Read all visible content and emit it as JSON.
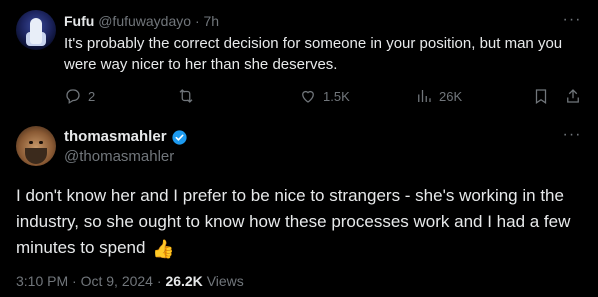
{
  "reply": {
    "name": "Fufu",
    "handle": "@fufuwaydayo",
    "separator": "·",
    "time": "7h",
    "text": "It's probably the correct decision for someone in your position, but man you were way nicer to her than she deserves.",
    "more": "···",
    "actions": {
      "replies": "2",
      "reposts": "",
      "likes": "1.5K",
      "views": "26K"
    }
  },
  "post": {
    "name": "thomasmahler",
    "handle": "@thomasmahler",
    "more": "···",
    "text": "I don't know her and I prefer to be nice to strangers - she's working in the industry, so she ought to know how these processes work and I had a few minutes to spend",
    "emoji": "👍",
    "time": "3:10 PM",
    "separator": "·",
    "date": "Oct 9, 2024",
    "separator2": "·",
    "views_count": "26.2K",
    "views_label": "Views"
  },
  "colors": {
    "background": "#000000",
    "text": "#e7e9ea",
    "muted": "#71767b",
    "verified": "#1d9bf0"
  }
}
